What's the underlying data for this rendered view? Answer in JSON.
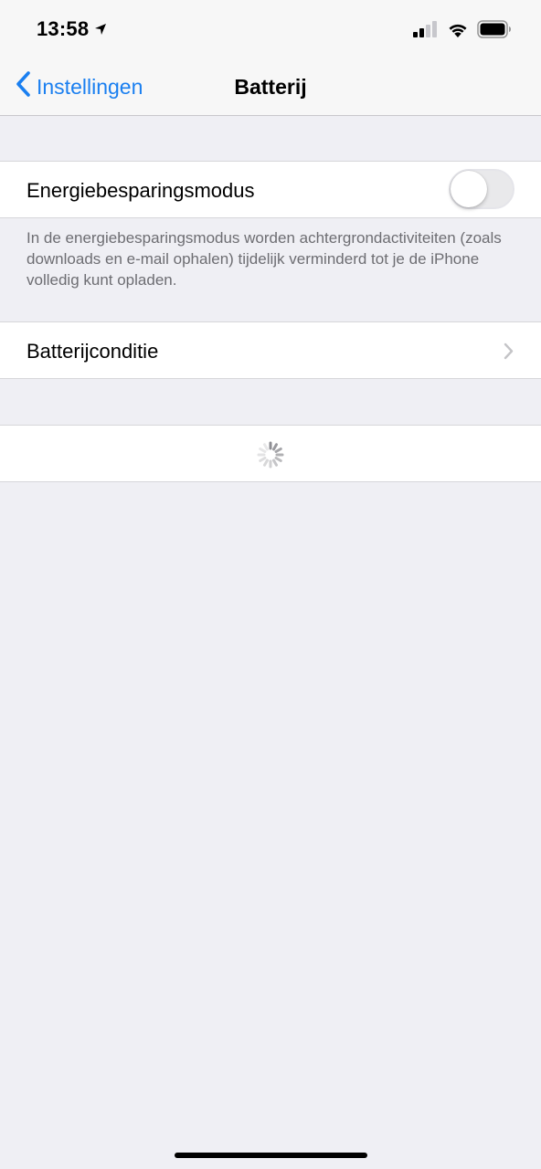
{
  "status_bar": {
    "time": "13:58",
    "icons": [
      "location-arrow-icon",
      "cellular-signal-icon",
      "wifi-icon",
      "battery-icon"
    ]
  },
  "nav": {
    "back_label": "Instellingen",
    "title": "Batterij"
  },
  "low_power": {
    "label": "Energiebesparingsmodus",
    "toggle_on": false,
    "footer": "In de energiebesparingsmodus worden achtergrondactiviteiten (zoals downloads en e-mail ophalen) tijdelijk verminderd tot je de iPhone volledig kunt opladen."
  },
  "battery_health": {
    "label": "Batterijconditie"
  },
  "loading": {
    "icon": "activity-spinner-icon"
  },
  "colors": {
    "accent": "#1a7ff0",
    "background": "#efeff4",
    "secondary_text": "#6d6d72"
  }
}
